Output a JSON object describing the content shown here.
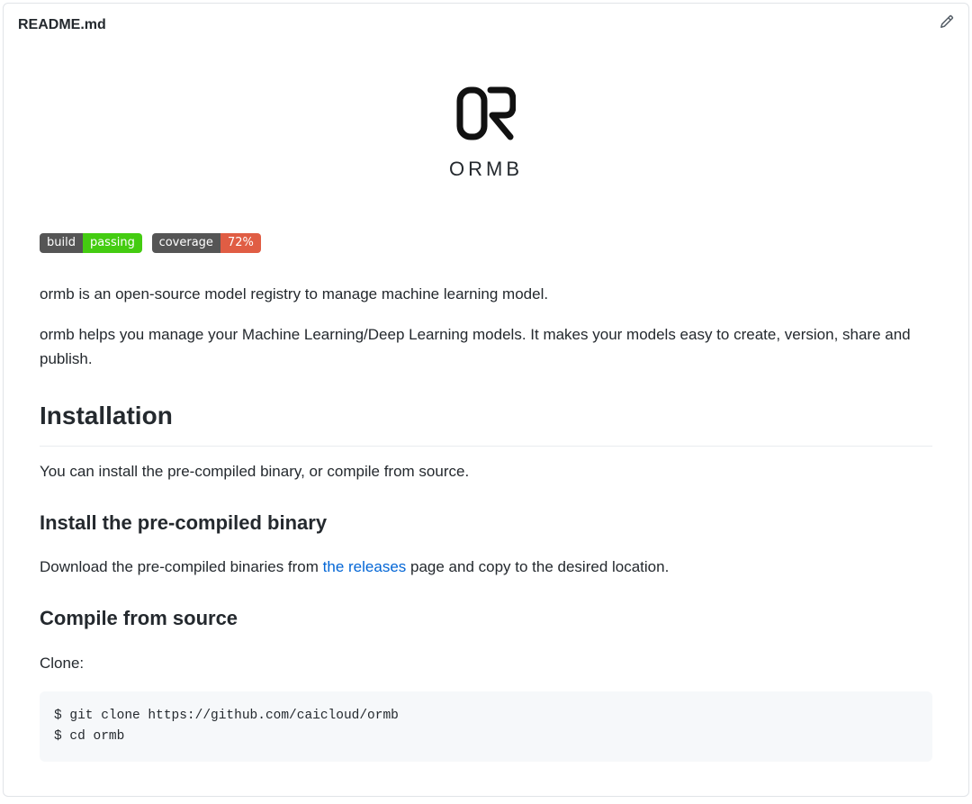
{
  "file": {
    "name": "README.md"
  },
  "logo": {
    "text": "ORMB"
  },
  "badges": {
    "build": {
      "label": "build",
      "status": "passing"
    },
    "coverage": {
      "label": "coverage",
      "value": "72%"
    }
  },
  "intro": {
    "p1": "ormb is an open-source model registry to manage machine learning model.",
    "p2": "ormb helps you manage your Machine Learning/Deep Learning models. It makes your models easy to create, version, share and publish."
  },
  "install": {
    "heading": "Installation",
    "text": "You can install the pre-compiled binary, or compile from source.",
    "precompiled": {
      "heading": "Install the pre-compiled binary",
      "before_link": "Download the pre-compiled binaries from ",
      "link_text": "the releases",
      "after_link": " page and copy to the desired location."
    },
    "compile": {
      "heading": "Compile from source",
      "clone_label": "Clone:",
      "code": "$ git clone https://github.com/caicloud/ormb\n$ cd ormb"
    }
  }
}
